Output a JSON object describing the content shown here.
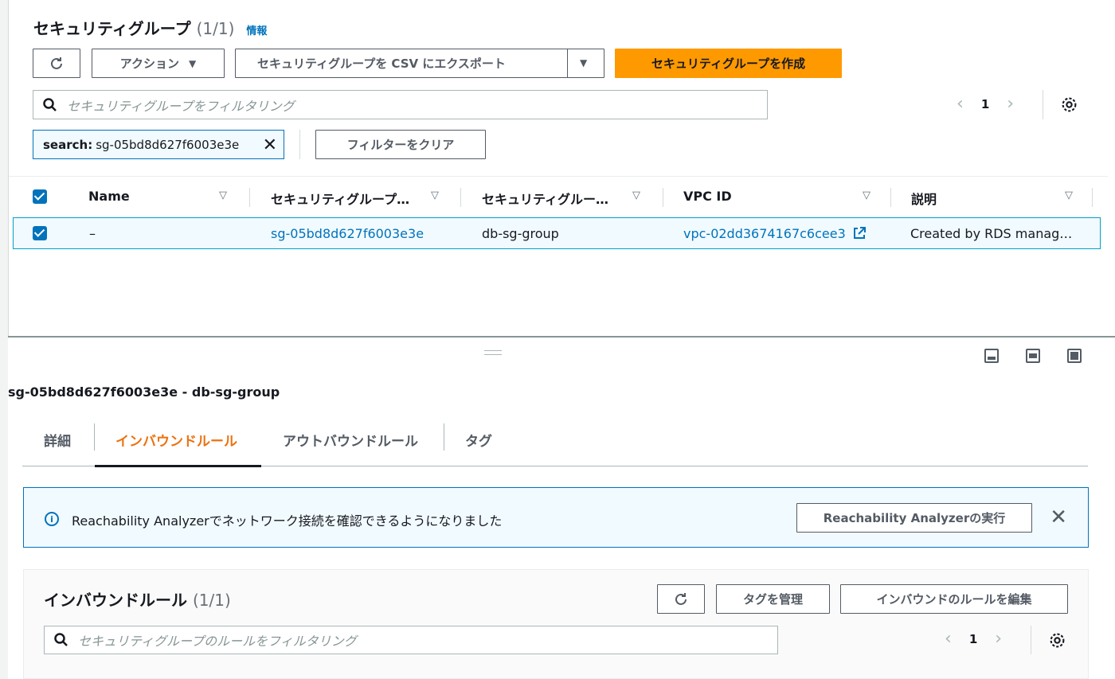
{
  "header": {
    "title": "セキュリティグループ",
    "count": "(1/1)",
    "info": "情報"
  },
  "toolbar": {
    "actions_label": "アクション",
    "export_label": "セキュリティグループを CSV にエクスポート",
    "create_label": "セキュリティグループを作成"
  },
  "search": {
    "placeholder": "セキュリティグループをフィルタリング",
    "token_key": "search:",
    "token_value": "sg-05bd8d627f6003e3e",
    "clear_label": "フィルターをクリア"
  },
  "pagination": {
    "page": "1"
  },
  "table": {
    "columns": [
      "Name",
      "セキュリティグループ…",
      "セキュリティグルー…",
      "VPC ID",
      "説明"
    ],
    "rows": [
      {
        "name": "–",
        "sg_id": "sg-05bd8d627f6003e3e",
        "sg_name": "db-sg-group",
        "vpc_id": "vpc-02dd3674167c6cee3",
        "description": "Created by RDS manag…"
      }
    ]
  },
  "detail": {
    "title": "sg-05bd8d627f6003e3e - db-sg-group",
    "tabs": [
      "詳細",
      "インバウンドルール",
      "アウトバウンドルール",
      "タグ"
    ],
    "active_tab": "インバウンドルール"
  },
  "flash": {
    "message": "Reachability Analyzerでネットワーク接続を確認できるようになりました",
    "action_label": "Reachability Analyzerの実行"
  },
  "inbound": {
    "title": "インバウンドルール",
    "count": "(1/1)",
    "manage_tags_label": "タグを管理",
    "edit_rules_label": "インバウンドのルールを編集",
    "filter_placeholder": "セキュリティグループのルールをフィルタリング",
    "page": "1"
  },
  "colors": {
    "primary": "#ff9900",
    "link": "#0073bb",
    "active_tab": "#ec7211"
  }
}
